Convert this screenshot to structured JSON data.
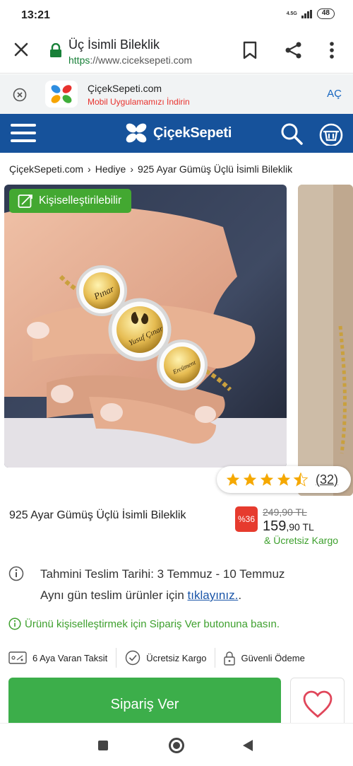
{
  "status_bar": {
    "time": "13:21",
    "network": "4.5G",
    "battery": "48"
  },
  "browser": {
    "title": "Üç İsimli Bileklik",
    "url_scheme": "https",
    "url_rest": "://www.ciceksepeti.com"
  },
  "app_banner": {
    "title": "ÇiçekSepeti.com",
    "subtitle": "Mobil Uygulamamızı İndirin",
    "open_label": "AÇ"
  },
  "header": {
    "logo_text": "ÇiçekSepeti"
  },
  "breadcrumb": {
    "items": [
      "ÇiçekSepeti.com",
      "Hediye",
      "925 Ayar Gümüş Üçlü İsimli Bileklik"
    ]
  },
  "gallery": {
    "badge_label": "Kişiselleştirilebilir",
    "engravings": [
      "Pınar",
      "Yusuf Çınar",
      "Ercüment"
    ]
  },
  "rating": {
    "stars": 4.5,
    "count": "(32)"
  },
  "product": {
    "name": "925 Ayar Gümüş Üçlü İsimli Bileklik",
    "discount": "%36",
    "old_price": "249,90 TL",
    "price_main": "159",
    "price_decimal": ",90 TL",
    "shipping": "& Ücretsiz Kargo"
  },
  "delivery": {
    "estimate": "Tahmini Teslim Tarihi: 3 Temmuz - 10 Temmuz",
    "same_day_prefix": "Aynı gün teslim ürünler için ",
    "same_day_link": "tıklayınız.",
    "same_day_suffix": "."
  },
  "personal_note": "Ürünü kişiselleştirmek için Sipariş Ver butonuna basın.",
  "features": [
    "6 Aya Varan Taksit",
    "Ücretsiz Kargo",
    "Güvenli Ödeme"
  ],
  "order_button_label": "Sipariş Ver",
  "colors": {
    "brand_blue": "#16529b",
    "green": "#3cae4a",
    "discount_red": "#e63b2e",
    "star": "#f5a800"
  }
}
